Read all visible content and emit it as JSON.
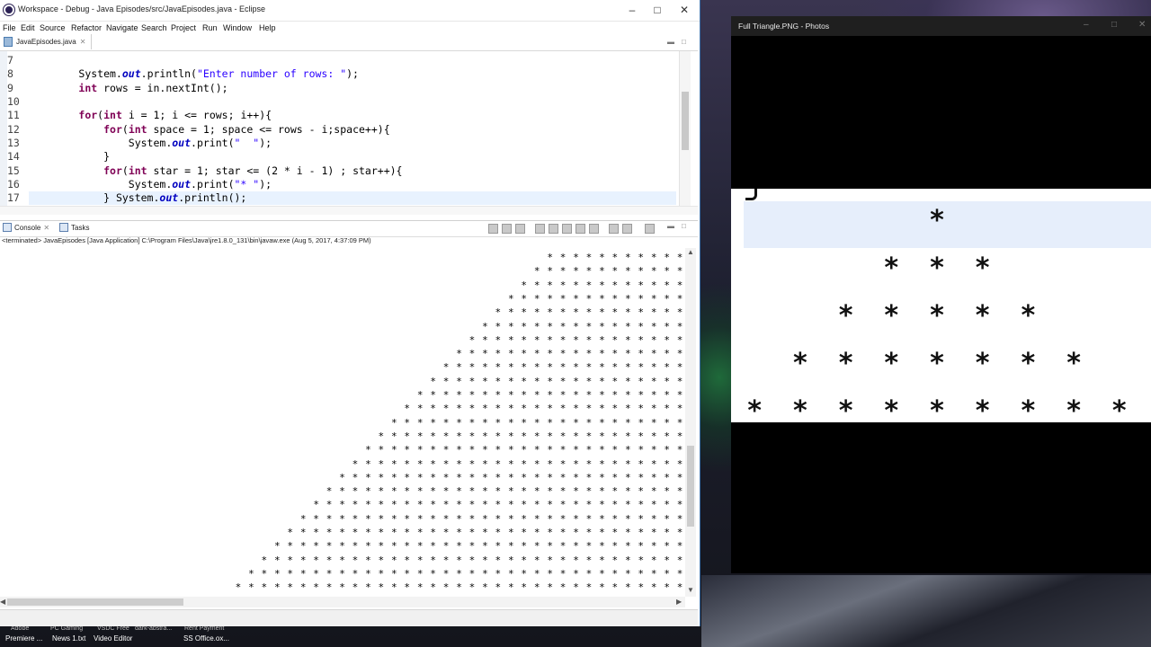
{
  "eclipse": {
    "title": "Workspace - Debug - Java Episodes/src/JavaEpisodes.java - Eclipse",
    "menu": [
      "File",
      "Edit",
      "Source",
      "Refactor",
      "Navigate",
      "Search",
      "Project",
      "Run",
      "Window",
      "Help"
    ],
    "editor_tab": "JavaEpisodes.java",
    "code": {
      "line_numbers": [
        "7",
        "8",
        "9",
        "10",
        "11",
        "12",
        "13",
        "14",
        "15",
        "16",
        "17"
      ],
      "lines": {
        "l8_a": "System.",
        "l8_b": "out",
        "l8_c": ".println(",
        "l8_d": "\"Enter number of rows: \"",
        "l8_e": ");",
        "l9_a": "int",
        "l9_b": " rows = in.nextInt();",
        "l11_a": "for",
        "l11_b": "(",
        "l11_c": "int",
        "l11_d": " i = 1; i <= rows; i++){",
        "l12_a": "for",
        "l12_b": "(",
        "l12_c": "int",
        "l12_d": " space = 1; space <= rows - i;space++){",
        "l13_a": "System.",
        "l13_b": "out",
        "l13_c": ".print(",
        "l13_d": "\"  \"",
        "l13_e": ");",
        "l14": "}",
        "l15_a": "for",
        "l15_b": "(",
        "l15_c": "int",
        "l15_d": " star = 1; star <= (2 * i - 1) ; star++){",
        "l16_a": "System.",
        "l16_b": "out",
        "l16_c": ".print(",
        "l16_d": "\"* \"",
        "l16_e": ");",
        "l17_a": "} System.",
        "l17_b": "out",
        "l17_c": ".println();"
      }
    },
    "console": {
      "tabs": [
        "Console",
        "Tasks"
      ],
      "terminated": "<terminated> JavaEpisodes [Java Application] C:\\Program Files\\Java\\jre1.8.0_131\\bin\\javaw.exe (Aug 5, 2017, 4:37:09 PM)",
      "star_counts": [
        11,
        12,
        13,
        14,
        15,
        16,
        17,
        18,
        19,
        20,
        21,
        22,
        23,
        24,
        25,
        26,
        27,
        28,
        29,
        30,
        31,
        32,
        33,
        34,
        35,
        36
      ]
    }
  },
  "photos": {
    "title": "Full Triangle.PNG - Photos",
    "triangle_rows": [
      1,
      3,
      5,
      7,
      9
    ]
  },
  "desktop": {
    "icons_top": [
      "Adobe",
      "PC Gaming",
      "VSDC Free",
      "dark-abstra...",
      "Rent Payment"
    ],
    "icons_bottom": [
      "Premiere ...",
      "News 1.txt",
      "Video Editor",
      "",
      "SS Office.ox..."
    ]
  },
  "colors": {
    "keyword": "#7f0055",
    "string": "#2a00ff",
    "field": "#0000c0",
    "current_line": "#e8f2fe"
  }
}
